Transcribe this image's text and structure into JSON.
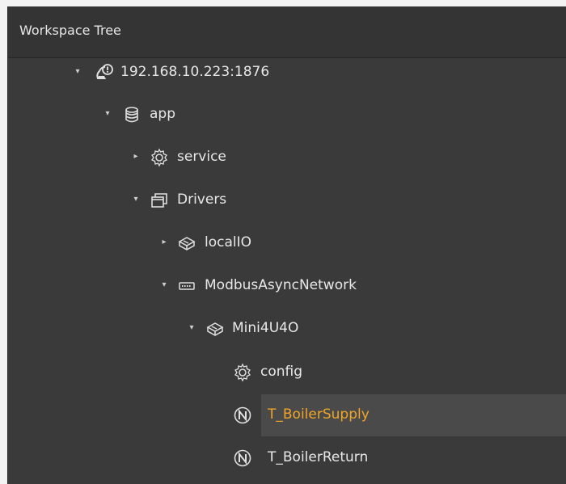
{
  "panel": {
    "title": "Workspace Tree"
  },
  "tree": {
    "root": {
      "label": "192.168.10.223:1876",
      "toggle": "▾",
      "icon": "server-alert-icon"
    },
    "app": {
      "label": "app",
      "toggle": "▾",
      "icon": "database-icon"
    },
    "service": {
      "label": "service",
      "toggle": "▸",
      "icon": "gear-icon"
    },
    "drivers": {
      "label": "Drivers",
      "toggle": "▾",
      "icon": "folders-icon"
    },
    "localio": {
      "label": "localIO",
      "toggle": "▸",
      "icon": "device-icon"
    },
    "modbus": {
      "label": "ModbusAsyncNetwork",
      "toggle": "▾",
      "icon": "network-port-icon"
    },
    "mini": {
      "label": "Mini4U4O",
      "toggle": "▾",
      "icon": "device-icon"
    },
    "config": {
      "label": "config",
      "icon": "gear-icon"
    },
    "boiler_supply": {
      "label": "T_BoilerSupply",
      "icon": "numeric-point-icon",
      "selected": true
    },
    "boiler_return": {
      "label": "T_BoilerReturn",
      "icon": "numeric-point-icon"
    }
  },
  "colors": {
    "panel_bg": "#3a3a3a",
    "selected_text": "#f0a526",
    "selected_bg": "#4a4a4a"
  }
}
